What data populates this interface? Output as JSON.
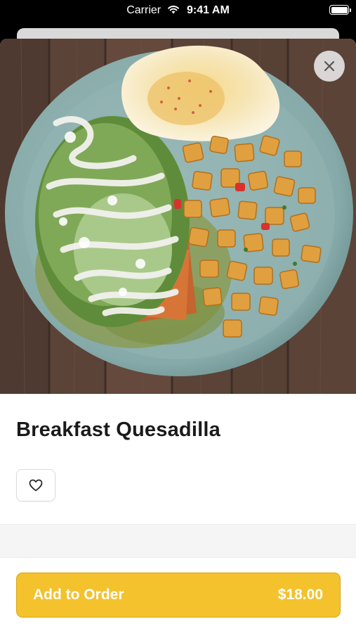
{
  "status_bar": {
    "carrier": "Carrier",
    "time": "9:41 AM"
  },
  "item": {
    "name": "Breakfast Quesadilla",
    "photo_alt": "plate with quesadilla, fried egg and potatoes"
  },
  "actions": {
    "add_label": "Add to Order",
    "price": "$18.00"
  },
  "icons": {
    "close": "close-icon",
    "favorite": "heart-outline-icon",
    "wifi": "wifi-icon",
    "battery": "battery-icon"
  },
  "colors": {
    "accent": "#F3C22C",
    "accent_border": "#D8A613",
    "plate": "#8FB3B2"
  }
}
